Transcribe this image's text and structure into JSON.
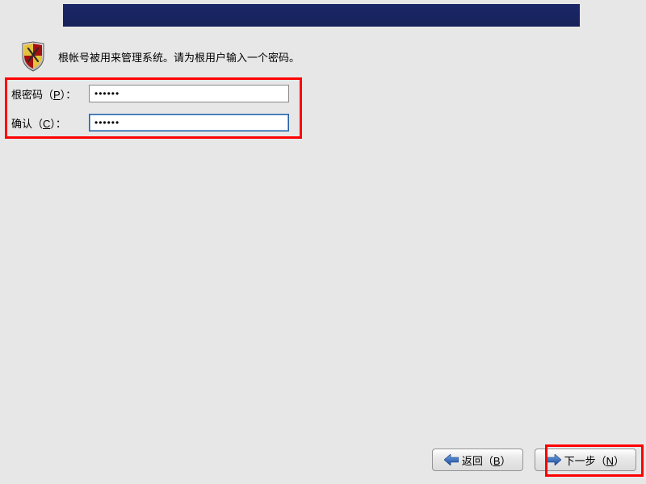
{
  "description": "根帐号被用来管理系统。请为根用户输入一个密码。",
  "form": {
    "password_label_pre": "根密码（",
    "password_label_ak": "P",
    "password_label_post": "）：",
    "password_value": "••••••",
    "confirm_label_pre": "确认（",
    "confirm_label_ak": "C",
    "confirm_label_post": "）：",
    "confirm_value": "••••••"
  },
  "buttons": {
    "back_pre": "返回（",
    "back_ak": "B",
    "back_post": "）",
    "next_pre": "下一步（",
    "next_ak": "N",
    "next_post": "）"
  },
  "colors": {
    "highlight": "#ff0000",
    "banner": "#17225b",
    "arrow_blue_light": "#5a95e0",
    "arrow_blue_dark": "#1b4a9a"
  }
}
